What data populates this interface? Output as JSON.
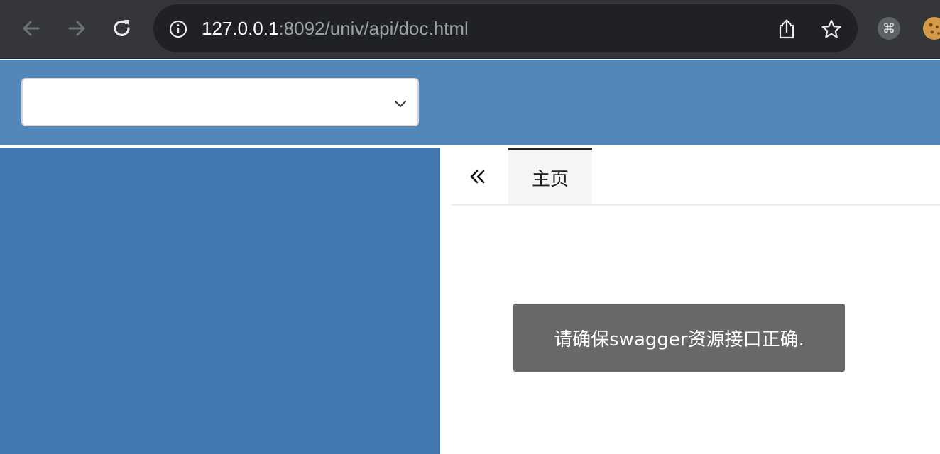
{
  "browser": {
    "url_host": "127.0.0.1",
    "url_rest": ":8092/univ/api/doc.html",
    "icons": {
      "back": "back-arrow-icon",
      "forward": "forward-arrow-icon",
      "reload": "reload-icon",
      "site_info": "info-icon",
      "share": "share-icon",
      "bookmark": "star-icon",
      "extension_1": "command-key-icon",
      "extension_2": "cookie-icon"
    },
    "extension_1_glyph": "⌘"
  },
  "header": {
    "group_select": {
      "selected_value": "",
      "icon": "chevron-down-icon"
    },
    "background_color": "#5287b8"
  },
  "sidebar": {
    "background_color": "#4377b2"
  },
  "main": {
    "collapse_icon": "double-chevron-left-icon",
    "tabs": [
      {
        "label": "主页",
        "active": true
      }
    ]
  },
  "toast": {
    "message": "请确保swagger资源接口正确."
  }
}
